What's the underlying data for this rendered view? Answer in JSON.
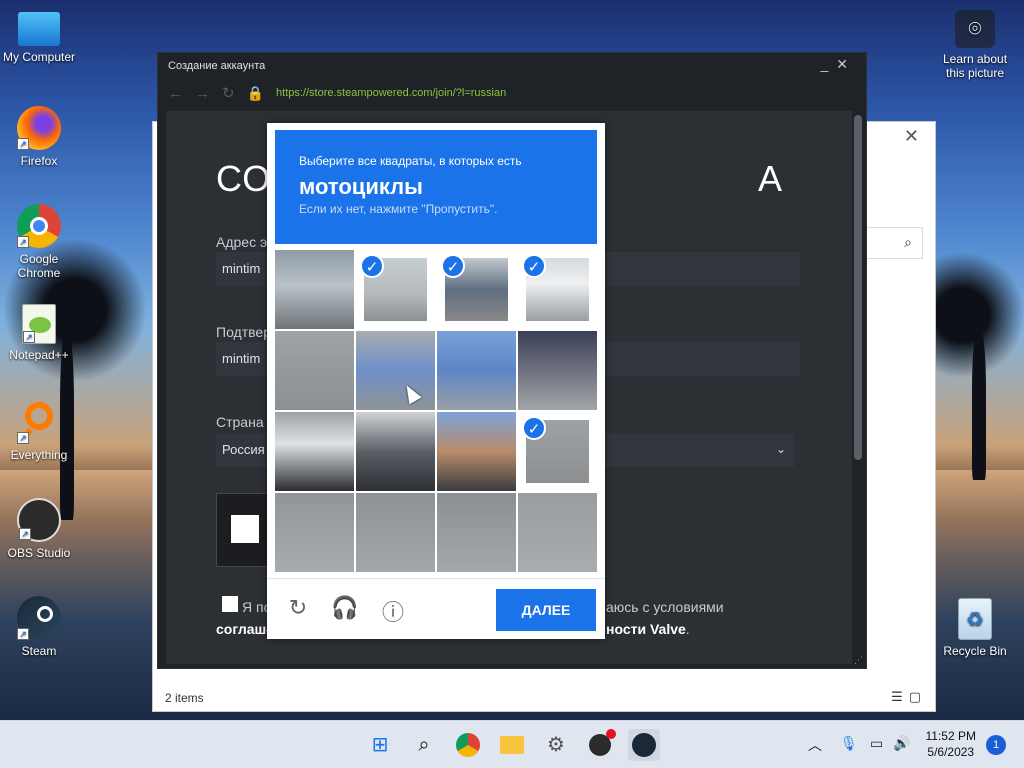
{
  "desktop": {
    "icons": [
      {
        "label": "My Computer"
      },
      {
        "label": "Firefox"
      },
      {
        "label": "Google Chrome"
      },
      {
        "label": "Notepad++"
      },
      {
        "label": "Everything"
      },
      {
        "label": "OBS Studio"
      },
      {
        "label": "Steam"
      }
    ],
    "learn_about": "Learn about this picture",
    "recycle_bin": "Recycle Bin"
  },
  "explorer": {
    "status": "2 items"
  },
  "steam_window": {
    "title": "Создание аккаунта",
    "url": "https://store.steampowered.com/join/?l=russian",
    "heading_start": "СО",
    "heading_end": "А",
    "email_label": "Адрес э",
    "email_value": "mintim",
    "confirm_label": "Подтвер",
    "confirm_value": "mintim",
    "country_label": "Страна",
    "country_value": "Россия",
    "agree_start": "Я по",
    "agree_tail": "аюсь с условиями",
    "agree_line2_start": "соглаше",
    "agree_line2_end": "ности Valve",
    "agree_line2_period": "."
  },
  "captcha": {
    "instruction": "Выберите все квадраты, в которых есть",
    "target": "мотоциклы",
    "hint": "Если их нет, нажмите \"Пропустить\".",
    "selected_tiles": [
      1,
      2,
      3,
      11
    ],
    "next_label": "ДАЛЕЕ",
    "brand_color": "#1a73e8"
  },
  "taskbar": {
    "time": "11:52 PM",
    "date": "5/6/2023",
    "notification_count": "1"
  }
}
